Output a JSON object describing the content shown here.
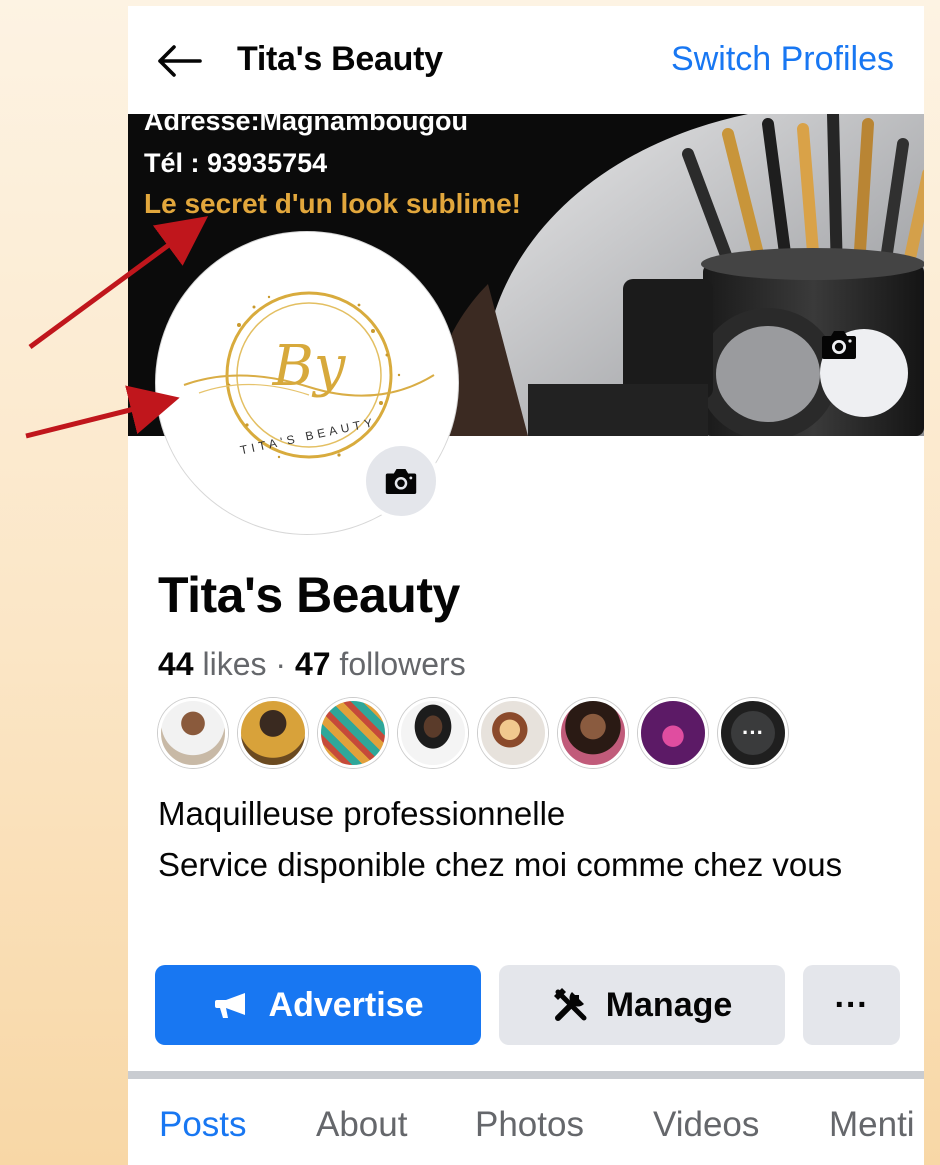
{
  "header": {
    "title": "Tita's Beauty",
    "switch_profiles": "Switch Profiles"
  },
  "cover": {
    "line1": "Adresse:Magnambougou",
    "line2": "Tél : 93935754",
    "line3": "Le secret d'un look sublime!"
  },
  "avatar": {
    "logo_text": "By",
    "logo_subtext": "TITA'S BEAUTY"
  },
  "page": {
    "name": "Tita's Beauty",
    "likes_count": "44",
    "likes_label": "likes",
    "separator": "·",
    "followers_count": "47",
    "followers_label": "followers",
    "bio_line1": "Maquilleuse professionnelle",
    "bio_line2": "Service disponible chez moi comme chez vous"
  },
  "friends_more": "···",
  "actions": {
    "advertise": "Advertise",
    "manage": "Manage",
    "more": "···"
  },
  "tabs": [
    "Posts",
    "About",
    "Photos",
    "Videos",
    "Menti"
  ],
  "colors": {
    "accent": "#1877f2",
    "annotation_arrow": "#c0161c",
    "cover_tagline": "#e2a73c"
  },
  "icons": {
    "back": "arrow-left-icon",
    "camera": "camera-icon",
    "megaphone": "megaphone-icon",
    "manage": "tools-icon"
  }
}
